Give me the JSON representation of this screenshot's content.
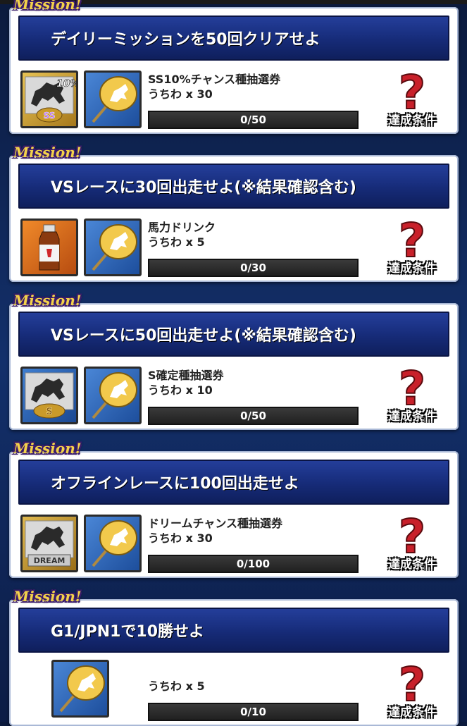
{
  "missions": [
    {
      "tag": "Mission!",
      "title": "デイリーミッションを50回クリアせよ",
      "reward_line1": "SS10%チャンス種抽選券",
      "reward_line2": "うちわ x 30",
      "progress": "0/50",
      "progress_fraction": 0,
      "condition_label": "達成条件",
      "icons": [
        "ss10-ticket-icon",
        "uchiwa-fan-icon"
      ],
      "ticket_badge": "10%",
      "ticket_emblem": "SS"
    },
    {
      "tag": "Mission!",
      "title": "VSレースに30回出走せよ(※結果確認含む)",
      "reward_line1": "馬力ドリンク",
      "reward_line2": "うちわ x 5",
      "progress": "0/30",
      "progress_fraction": 0,
      "condition_label": "達成条件",
      "icons": [
        "horsepower-drink-icon",
        "uchiwa-fan-icon"
      ]
    },
    {
      "tag": "Mission!",
      "title": "VSレースに50回出走せよ(※結果確認含む)",
      "reward_line1": "S確定種抽選券",
      "reward_line2": "うちわ x 10",
      "progress": "0/50",
      "progress_fraction": 0,
      "condition_label": "達成条件",
      "icons": [
        "s-ticket-icon",
        "uchiwa-fan-icon"
      ],
      "ticket_emblem": "S"
    },
    {
      "tag": "Mission!",
      "title": "オフラインレースに100回出走せよ",
      "reward_line1": "ドリームチャンス種抽選券",
      "reward_line2": "うちわ x 30",
      "progress": "0/100",
      "progress_fraction": 0,
      "condition_label": "達成条件",
      "icons": [
        "dream-ticket-icon",
        "uchiwa-fan-icon"
      ],
      "ticket_emblem": "DREAM"
    },
    {
      "tag": "Mission!",
      "title": "G1/JPN1で10勝せよ",
      "reward_line1": "",
      "reward_line2": "うちわ x 5",
      "progress": "0/10",
      "progress_fraction": 0,
      "condition_label": "達成条件",
      "icons": [
        "uchiwa-fan-icon"
      ]
    }
  ],
  "colors": {
    "title_bar": "#162b78",
    "mission_tag": "#f3d24a",
    "question_mark": "#c8202a",
    "card": "#ffffff",
    "background": "#13306b"
  }
}
